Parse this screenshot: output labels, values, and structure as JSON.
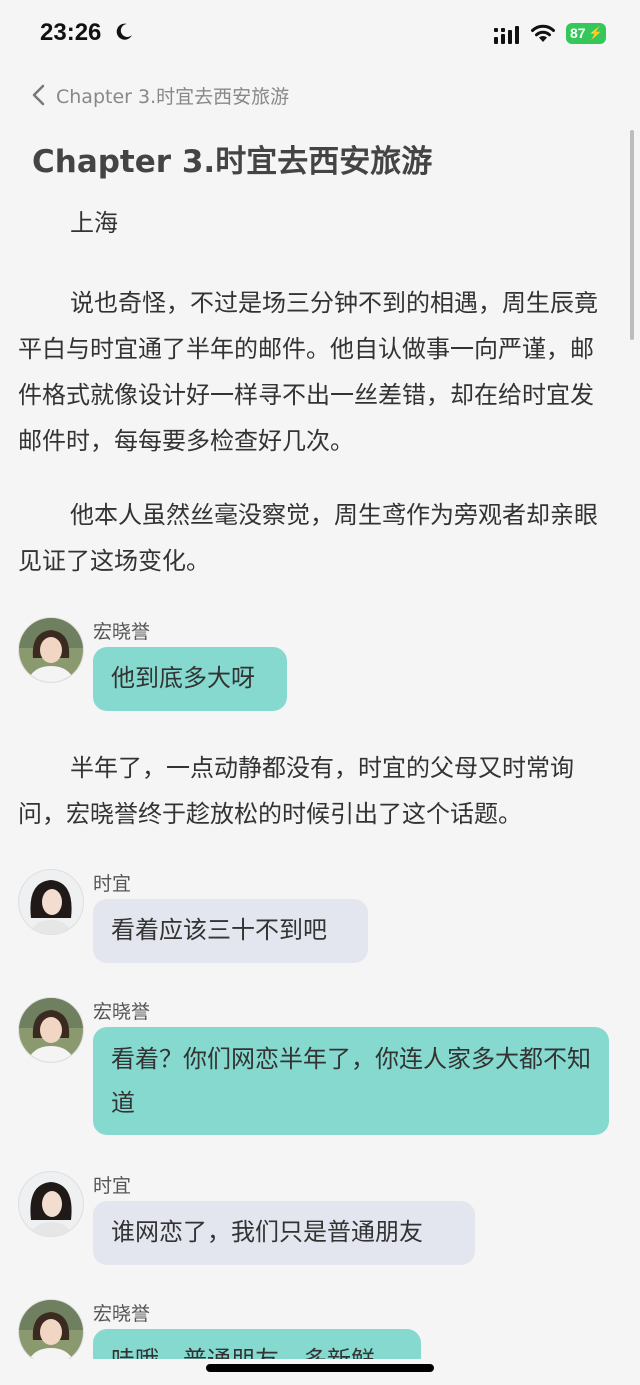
{
  "status": {
    "time": "23:26",
    "battery": "87"
  },
  "nav": {
    "back_title": "Chapter 3.时宜去西安旅游"
  },
  "chapter": {
    "title": "Chapter 3.时宜去西安旅游"
  },
  "paragraphs": [
    "上海",
    "说也奇怪，不过是场三分钟不到的相遇，周生辰竟平白与时宜通了半年的邮件。他自认做事一向严谨，邮件格式就像设计好一样寻不出一丝差错，却在给时宜发邮件时，每每要多检查好几次。",
    "他本人虽然丝毫没察觉，周生鸢作为旁观者却亲眼见证了这场变化。",
    "半年了，一点动静都没有，时宜的父母又时常询问，宏晓誉终于趁放松的时候引出了这个话题。"
  ],
  "messages": [
    {
      "sender": "宏晓誉",
      "text": "他到底多大呀"
    },
    {
      "sender": "时宜",
      "text": "看着应该三十不到吧"
    },
    {
      "sender": "宏晓誉",
      "text": "看着？你们网恋半年了，你连人家多大都不知道"
    },
    {
      "sender": "时宜",
      "text": "谁网恋了，我们只是普通朋友"
    },
    {
      "sender": "宏晓誉",
      "text": "哇哦，普通朋友，多新鲜"
    }
  ],
  "colors": {
    "teal_bubble": "#86d9cf",
    "gray_bubble": "#e3e6ee",
    "battery": "#34c759"
  }
}
